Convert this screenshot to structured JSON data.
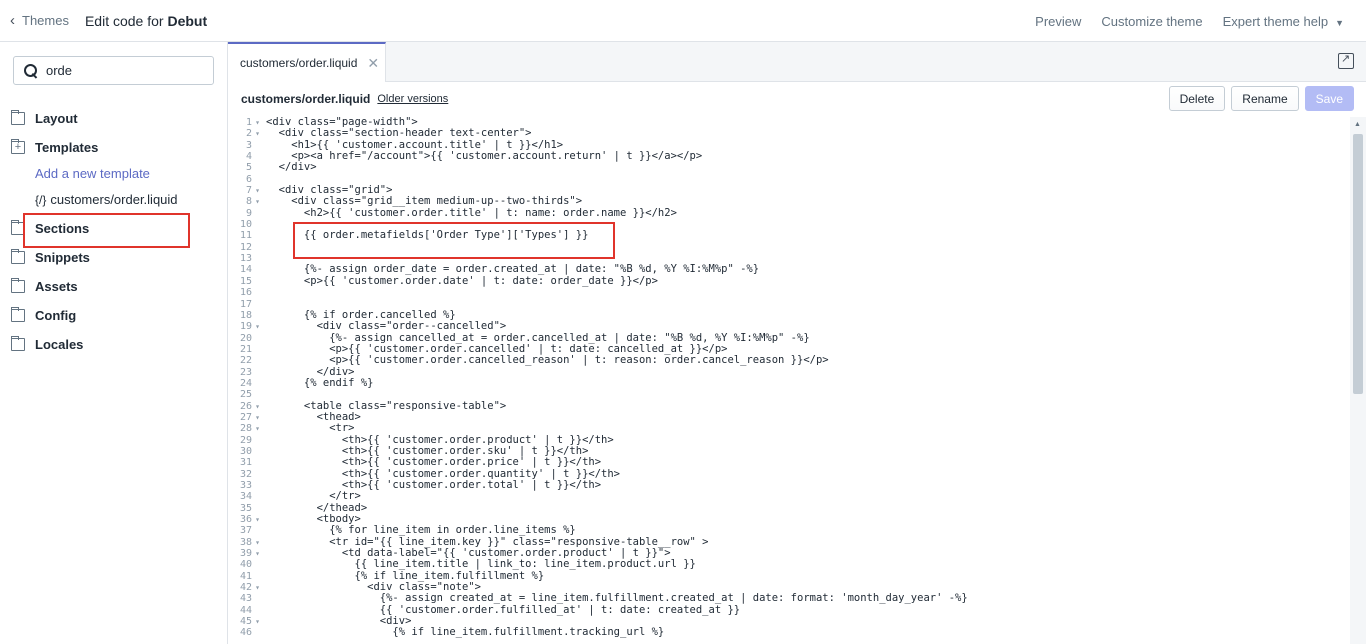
{
  "topbar": {
    "back_label": "Themes",
    "title_prefix": "Edit code for",
    "theme_name": "Debut",
    "preview": "Preview",
    "customize": "Customize theme",
    "expert_help": "Expert theme help"
  },
  "sidebar": {
    "search_value": "orde",
    "folders": [
      "Layout",
      "Templates",
      "Sections",
      "Snippets",
      "Assets",
      "Config",
      "Locales"
    ],
    "add_template": "Add a new template",
    "file_icon": "{/}",
    "file_name": "customers/order.liquid"
  },
  "editor": {
    "tab_label": "customers/order.liquid",
    "file_name": "customers/order.liquid",
    "older_versions": "Older versions",
    "delete": "Delete",
    "rename": "Rename",
    "save": "Save",
    "lines": [
      {
        "n": "1",
        "f": "▾",
        "t": "<div class=\"page-width\">"
      },
      {
        "n": "2",
        "f": "▾",
        "t": "  <div class=\"section-header text-center\">"
      },
      {
        "n": "3",
        "f": "",
        "t": "    <h1>{{ 'customer.account.title' | t }}</h1>"
      },
      {
        "n": "4",
        "f": "",
        "t": "    <p><a href=\"/account\">{{ 'customer.account.return' | t }}</a></p>"
      },
      {
        "n": "5",
        "f": "",
        "t": "  </div>"
      },
      {
        "n": "6",
        "f": "",
        "t": ""
      },
      {
        "n": "7",
        "f": "▾",
        "t": "  <div class=\"grid\">"
      },
      {
        "n": "8",
        "f": "▾",
        "t": "    <div class=\"grid__item medium-up--two-thirds\">"
      },
      {
        "n": "9",
        "f": "",
        "t": "      <h2>{{ 'customer.order.title' | t: name: order.name }}</h2>"
      },
      {
        "n": "10",
        "f": "",
        "t": ""
      },
      {
        "n": "11",
        "f": "",
        "t": "      {{ order.metafields['Order Type']['Types'] }}"
      },
      {
        "n": "12",
        "f": "",
        "t": ""
      },
      {
        "n": "13",
        "f": "",
        "t": ""
      },
      {
        "n": "14",
        "f": "",
        "t": "      {%- assign order_date = order.created_at | date: \"%B %d, %Y %I:%M%p\" -%}"
      },
      {
        "n": "15",
        "f": "",
        "t": "      <p>{{ 'customer.order.date' | t: date: order_date }}</p>"
      },
      {
        "n": "16",
        "f": "",
        "t": ""
      },
      {
        "n": "17",
        "f": "",
        "t": ""
      },
      {
        "n": "18",
        "f": "",
        "t": "      {% if order.cancelled %}"
      },
      {
        "n": "19",
        "f": "▾",
        "t": "        <div class=\"order--cancelled\">"
      },
      {
        "n": "20",
        "f": "",
        "t": "          {%- assign cancelled_at = order.cancelled_at | date: \"%B %d, %Y %I:%M%p\" -%}"
      },
      {
        "n": "21",
        "f": "",
        "t": "          <p>{{ 'customer.order.cancelled' | t: date: cancelled_at }}</p>"
      },
      {
        "n": "22",
        "f": "",
        "t": "          <p>{{ 'customer.order.cancelled_reason' | t: reason: order.cancel_reason }}</p>"
      },
      {
        "n": "23",
        "f": "",
        "t": "        </div>"
      },
      {
        "n": "24",
        "f": "",
        "t": "      {% endif %}"
      },
      {
        "n": "25",
        "f": "",
        "t": ""
      },
      {
        "n": "26",
        "f": "▾",
        "t": "      <table class=\"responsive-table\">"
      },
      {
        "n": "27",
        "f": "▾",
        "t": "        <thead>"
      },
      {
        "n": "28",
        "f": "▾",
        "t": "          <tr>"
      },
      {
        "n": "29",
        "f": "",
        "t": "            <th>{{ 'customer.order.product' | t }}</th>"
      },
      {
        "n": "30",
        "f": "",
        "t": "            <th>{{ 'customer.order.sku' | t }}</th>"
      },
      {
        "n": "31",
        "f": "",
        "t": "            <th>{{ 'customer.order.price' | t }}</th>"
      },
      {
        "n": "32",
        "f": "",
        "t": "            <th>{{ 'customer.order.quantity' | t }}</th>"
      },
      {
        "n": "33",
        "f": "",
        "t": "            <th>{{ 'customer.order.total' | t }}</th>"
      },
      {
        "n": "34",
        "f": "",
        "t": "          </tr>"
      },
      {
        "n": "35",
        "f": "",
        "t": "        </thead>"
      },
      {
        "n": "36",
        "f": "▾",
        "t": "        <tbody>"
      },
      {
        "n": "37",
        "f": "",
        "t": "          {% for line_item in order.line_items %}"
      },
      {
        "n": "38",
        "f": "▾",
        "t": "          <tr id=\"{{ line_item.key }}\" class=\"responsive-table__row\" >"
      },
      {
        "n": "39",
        "f": "▾",
        "t": "            <td data-label=\"{{ 'customer.order.product' | t }}\">"
      },
      {
        "n": "40",
        "f": "",
        "t": "              {{ line_item.title | link_to: line_item.product.url }}"
      },
      {
        "n": "41",
        "f": "",
        "t": "              {% if line_item.fulfillment %}"
      },
      {
        "n": "42",
        "f": "▾",
        "t": "                <div class=\"note\">"
      },
      {
        "n": "43",
        "f": "",
        "t": "                  {%- assign created_at = line_item.fulfillment.created_at | date: format: 'month_day_year' -%}"
      },
      {
        "n": "44",
        "f": "",
        "t": "                  {{ 'customer.order.fulfilled_at' | t: date: created_at }}"
      },
      {
        "n": "45",
        "f": "▾",
        "t": "                  <div>"
      },
      {
        "n": "46",
        "f": "",
        "t": "                    {% if line_item.fulfillment.tracking_url %}"
      }
    ]
  }
}
